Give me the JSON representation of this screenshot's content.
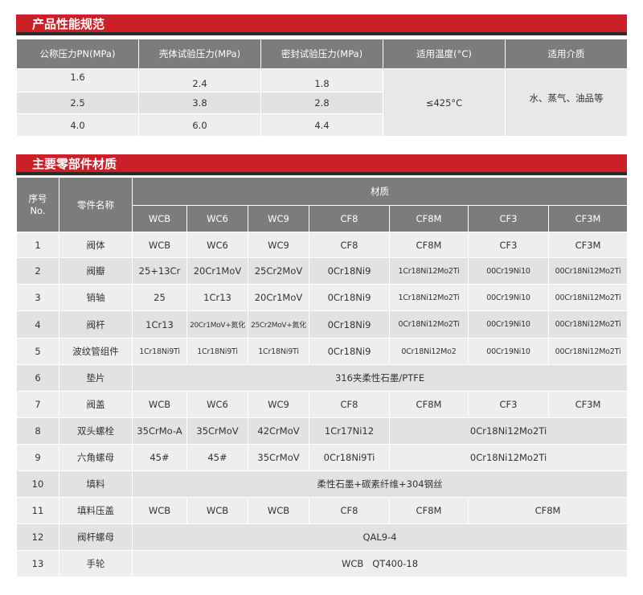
{
  "performance": {
    "title": "产品性能规范",
    "headers": [
      "公称压力PN(MPa)",
      "壳体试验压力(MPa)",
      "密封试验压力(MPa)",
      "适用温度(°C)",
      "适用介质"
    ],
    "rows": [
      [
        "1.6",
        "2.4",
        "1.8"
      ],
      [
        "2.5",
        "3.8",
        "2.8"
      ],
      [
        "4.0",
        "6.0",
        "4.4"
      ]
    ],
    "temperature": "≤425°C",
    "medium": "水、蒸气、油品等"
  },
  "parts": {
    "title": "主要零部件材质",
    "header_no": "序号\nNo.",
    "header_no_cn": "序号",
    "header_no_en": "No.",
    "header_name": "零件名称",
    "header_material": "材质",
    "grades": [
      "WCB",
      "WC6",
      "WC9",
      "CF8",
      "CF8M",
      "CF3",
      "CF3M"
    ],
    "rows": [
      {
        "no": "1",
        "name": "阀体",
        "cells": [
          "WCB",
          "WC6",
          "WC9",
          "CF8",
          "CF8M",
          "CF3",
          "CF3M"
        ]
      },
      {
        "no": "2",
        "name": "阀瓣",
        "cells": [
          "25+13Cr",
          "20Cr1MoV",
          "25Cr2MoV",
          "0Cr18Ni9",
          "1Cr18Ni12Mo2Ti",
          "00Cr19Ni10",
          "00Cr18Ni12Mo2Ti"
        ]
      },
      {
        "no": "3",
        "name": "销轴",
        "cells": [
          "25",
          "1Cr13",
          "20Cr1MoV",
          "0Cr18Ni9",
          "1Cr18Ni12Mo2Ti",
          "00Cr19Ni10",
          "00Cr18Ni12Mo2Ti"
        ]
      },
      {
        "no": "4",
        "name": "阀杆",
        "cells": [
          "1Cr13",
          "20Cr1MoV+氮化",
          "25Cr2MoV+氮化",
          "0Cr18Ni9",
          "0Cr18Ni12Mo2Ti",
          "00Cr19Ni10",
          "00Cr18Ni12Mo2Ti"
        ]
      },
      {
        "no": "5",
        "name": "波纹管组件",
        "cells": [
          "1Cr18Ni9Ti",
          "1Cr18Ni9Ti",
          "1Cr18Ni9Ti",
          "0Cr18Ni9",
          "0Cr18Ni12Mo2",
          "00Cr19Ni10",
          "00Cr18Ni12Mo2Ti"
        ]
      },
      {
        "no": "6",
        "name": "垫片",
        "span": "316夹柔性石墨/PTFE"
      },
      {
        "no": "7",
        "name": "阀盖",
        "cells": [
          "WCB",
          "WC6",
          "WC9",
          "CF8",
          "CF8M",
          "CF3",
          "CF3M"
        ]
      },
      {
        "no": "8",
        "name": "双头螺栓",
        "cells": [
          "35CrMo-A",
          "35CrMoV",
          "42CrMoV",
          "1Cr17Ni12"
        ],
        "tail": "0Cr18Ni12Mo2Ti"
      },
      {
        "no": "9",
        "name": "六角螺母",
        "cells": [
          "45#",
          "45#",
          "35CrMoV",
          "0Cr18Ni9Ti"
        ],
        "tail": "0Cr18Ni12Mo2Ti"
      },
      {
        "no": "10",
        "name": "填料",
        "span": "柔性石墨+碳素纤维+304钢丝"
      },
      {
        "no": "11",
        "name": "填料压盖",
        "cells": [
          "WCB",
          "WCB",
          "WCB",
          "CF8",
          "CF8M"
        ],
        "tail": "CF8M"
      },
      {
        "no": "12",
        "name": "阀杆螺母",
        "span": "QAL9-4"
      },
      {
        "no": "13",
        "name": "手轮",
        "span": "WCB   QT400-18"
      }
    ]
  },
  "colors": {
    "accent": "#cc2029",
    "header": "#7c7c7c",
    "cell": "#eeeeee",
    "cell_alt": "#e2e2e2"
  }
}
